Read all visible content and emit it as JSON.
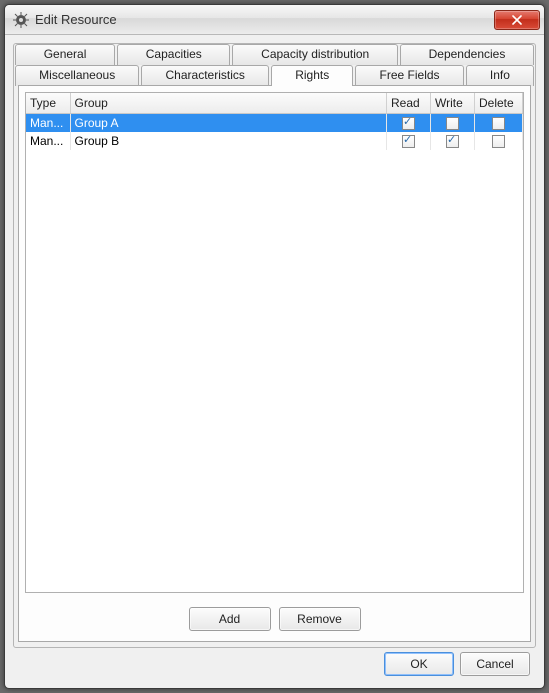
{
  "window": {
    "title": "Edit Resource"
  },
  "tabs": {
    "row1": [
      "General",
      "Capacities",
      "Capacity distribution",
      "Dependencies"
    ],
    "row2": [
      "Miscellaneous",
      "Characteristics",
      "Rights",
      "Free Fields",
      "Info"
    ],
    "active": "Rights"
  },
  "table": {
    "headers": {
      "type": "Type",
      "group": "Group",
      "read": "Read",
      "write": "Write",
      "delete": "Delete"
    },
    "rows": [
      {
        "type": "Man...",
        "group": "Group A",
        "read": true,
        "write": false,
        "delete": false,
        "selected": true
      },
      {
        "type": "Man...",
        "group": "Group B",
        "read": true,
        "write": true,
        "delete": false,
        "selected": false
      }
    ]
  },
  "buttons": {
    "add": "Add",
    "remove": "Remove",
    "ok": "OK",
    "cancel": "Cancel"
  }
}
